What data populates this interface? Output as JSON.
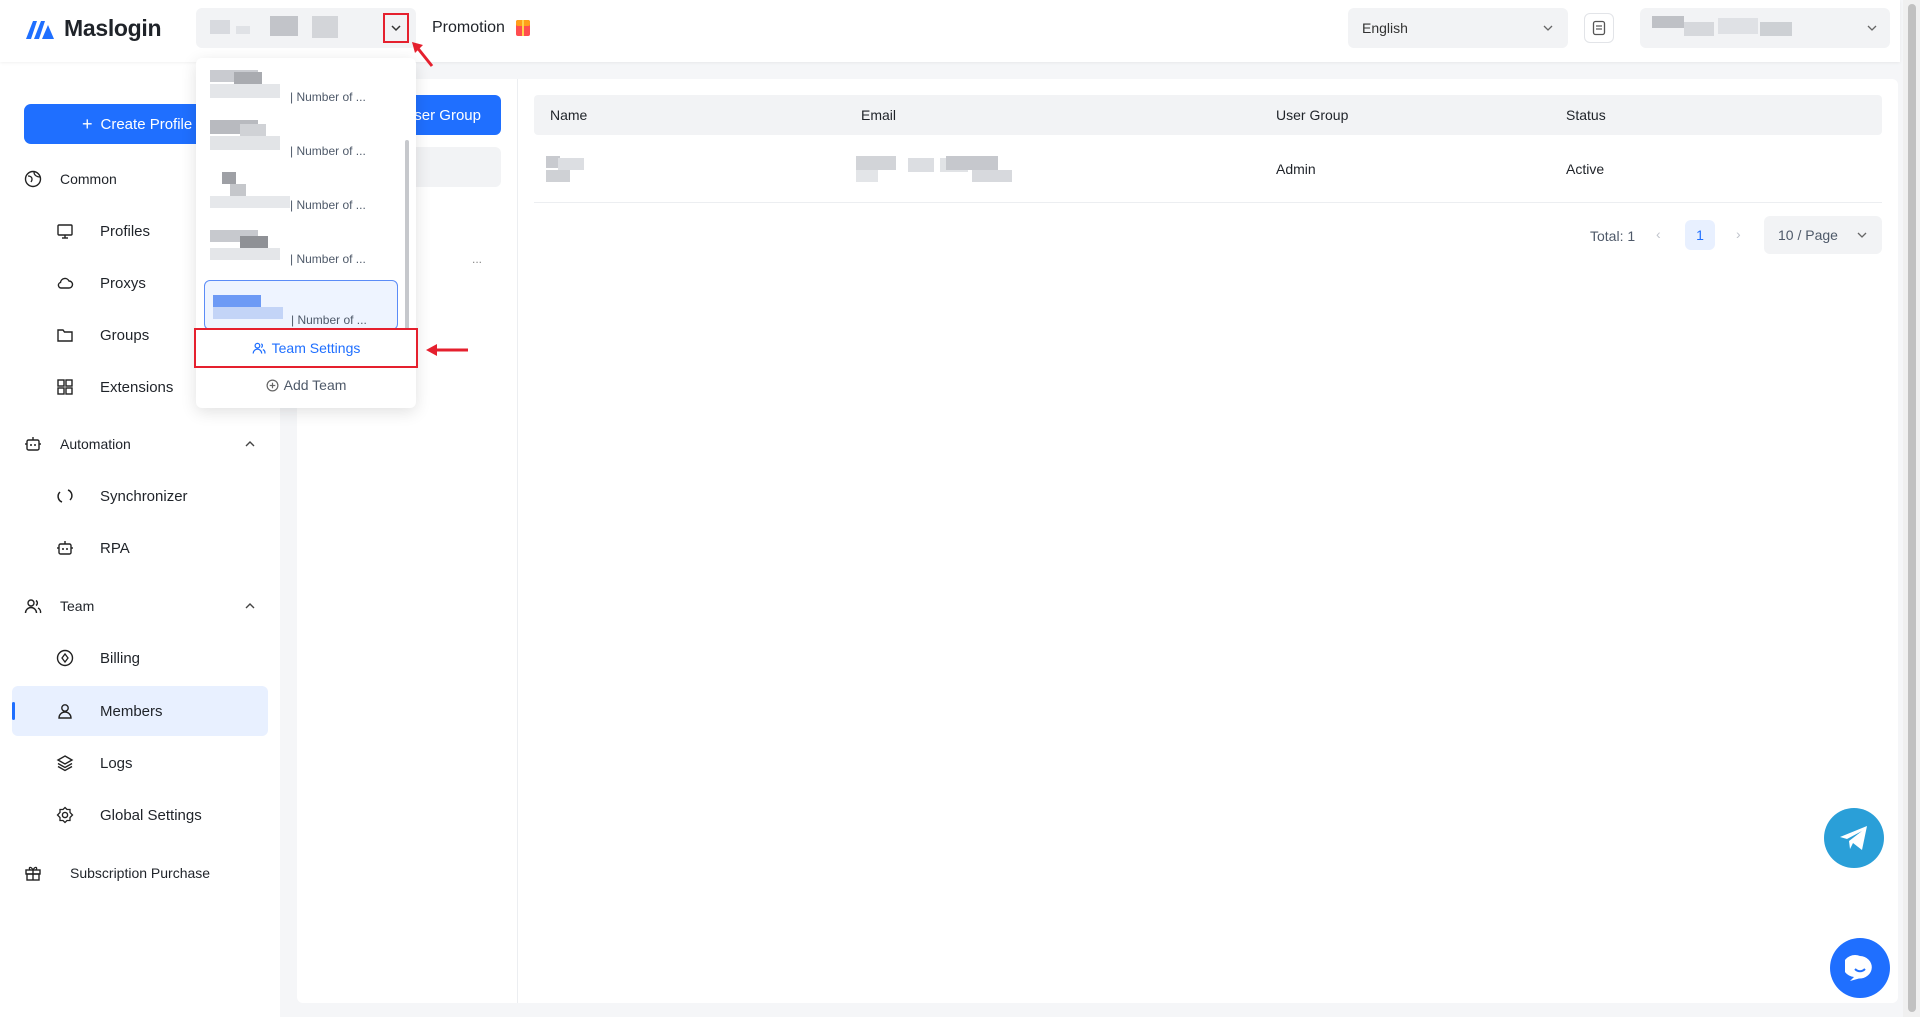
{
  "app": {
    "name": "Maslogin"
  },
  "header": {
    "promotion_label": "Promotion",
    "language": "English"
  },
  "sidebar": {
    "create_label": "Create Profile",
    "sections": [
      {
        "label": "Common"
      },
      {
        "label": "Automation"
      },
      {
        "label": "Team"
      }
    ],
    "items": [
      {
        "label": "Profiles",
        "icon": "monitor-icon"
      },
      {
        "label": "Proxys",
        "icon": "cloud-icon"
      },
      {
        "label": "Groups",
        "icon": "folder-icon"
      },
      {
        "label": "Extensions",
        "icon": "grid-icon"
      },
      {
        "label": "Synchronizer",
        "icon": "sync-icon"
      },
      {
        "label": "RPA",
        "icon": "robot-icon"
      },
      {
        "label": "Billing",
        "icon": "billing-icon"
      },
      {
        "label": "Members",
        "icon": "user-icon"
      },
      {
        "label": "Logs",
        "icon": "layers-icon"
      },
      {
        "label": "Global Settings",
        "icon": "gear-icon"
      }
    ],
    "subscription_label": "Subscription Purchase",
    "active_item": "Members"
  },
  "groups": {
    "add_button_tail": "ser Group",
    "more": "..."
  },
  "team_dropdown": {
    "count_label": "| Number of ...",
    "team_settings": "Team Settings",
    "add_team": "Add Team"
  },
  "table": {
    "columns": [
      "Name",
      "Email",
      "User Group",
      "Status"
    ],
    "rows": [
      {
        "user_group": "Admin",
        "status": "Active"
      }
    ]
  },
  "pagination": {
    "total": "Total: 1",
    "current": "1",
    "page_size": "10 / Page"
  },
  "colors": {
    "accent": "#1f6fff",
    "highlight": "#e5202e",
    "telegram": "#2a9fd8"
  }
}
